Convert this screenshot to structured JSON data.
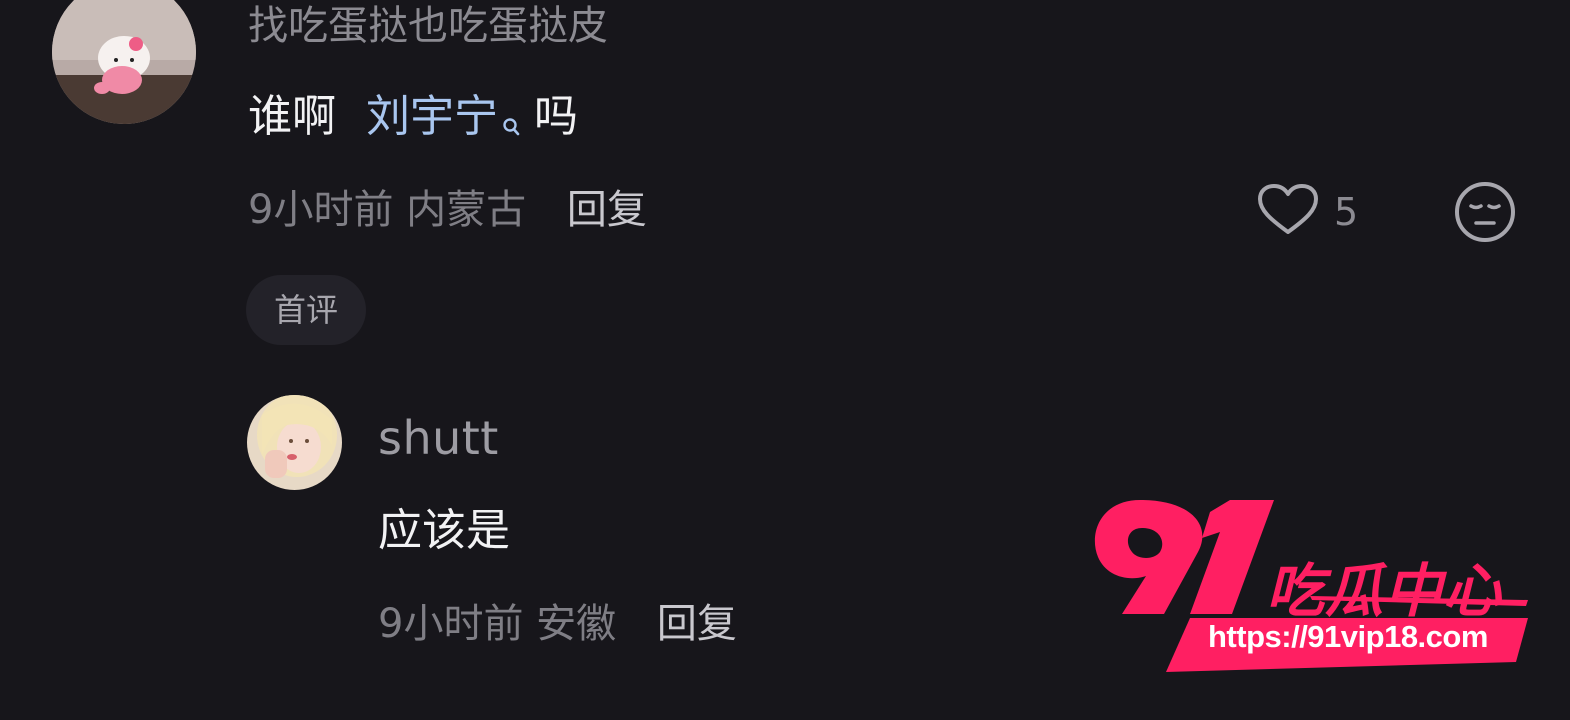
{
  "comment": {
    "previous_text": "找吃蛋挞也吃蛋挞皮",
    "text_before": "谁啊",
    "mention": "刘宇宁",
    "text_after": "吗",
    "time": "9小时前",
    "location": "内蒙古",
    "reply_label": "回复",
    "like_count": "5",
    "badge": "首评"
  },
  "reply": {
    "username": "shutt",
    "text": "应该是",
    "time": "9小时前",
    "location": "安徽",
    "reply_label": "回复"
  },
  "watermark": {
    "number": "91",
    "title": "吃瓜中心",
    "url": "https://91vip18.com"
  },
  "icons": {
    "like": "heart-outline-icon",
    "dislike": "unamused-face-icon",
    "mention_search": "search-icon"
  },
  "colors": {
    "background": "#17161b",
    "mention": "#a9c6ef",
    "watermark_accent": "#ff1f62"
  }
}
